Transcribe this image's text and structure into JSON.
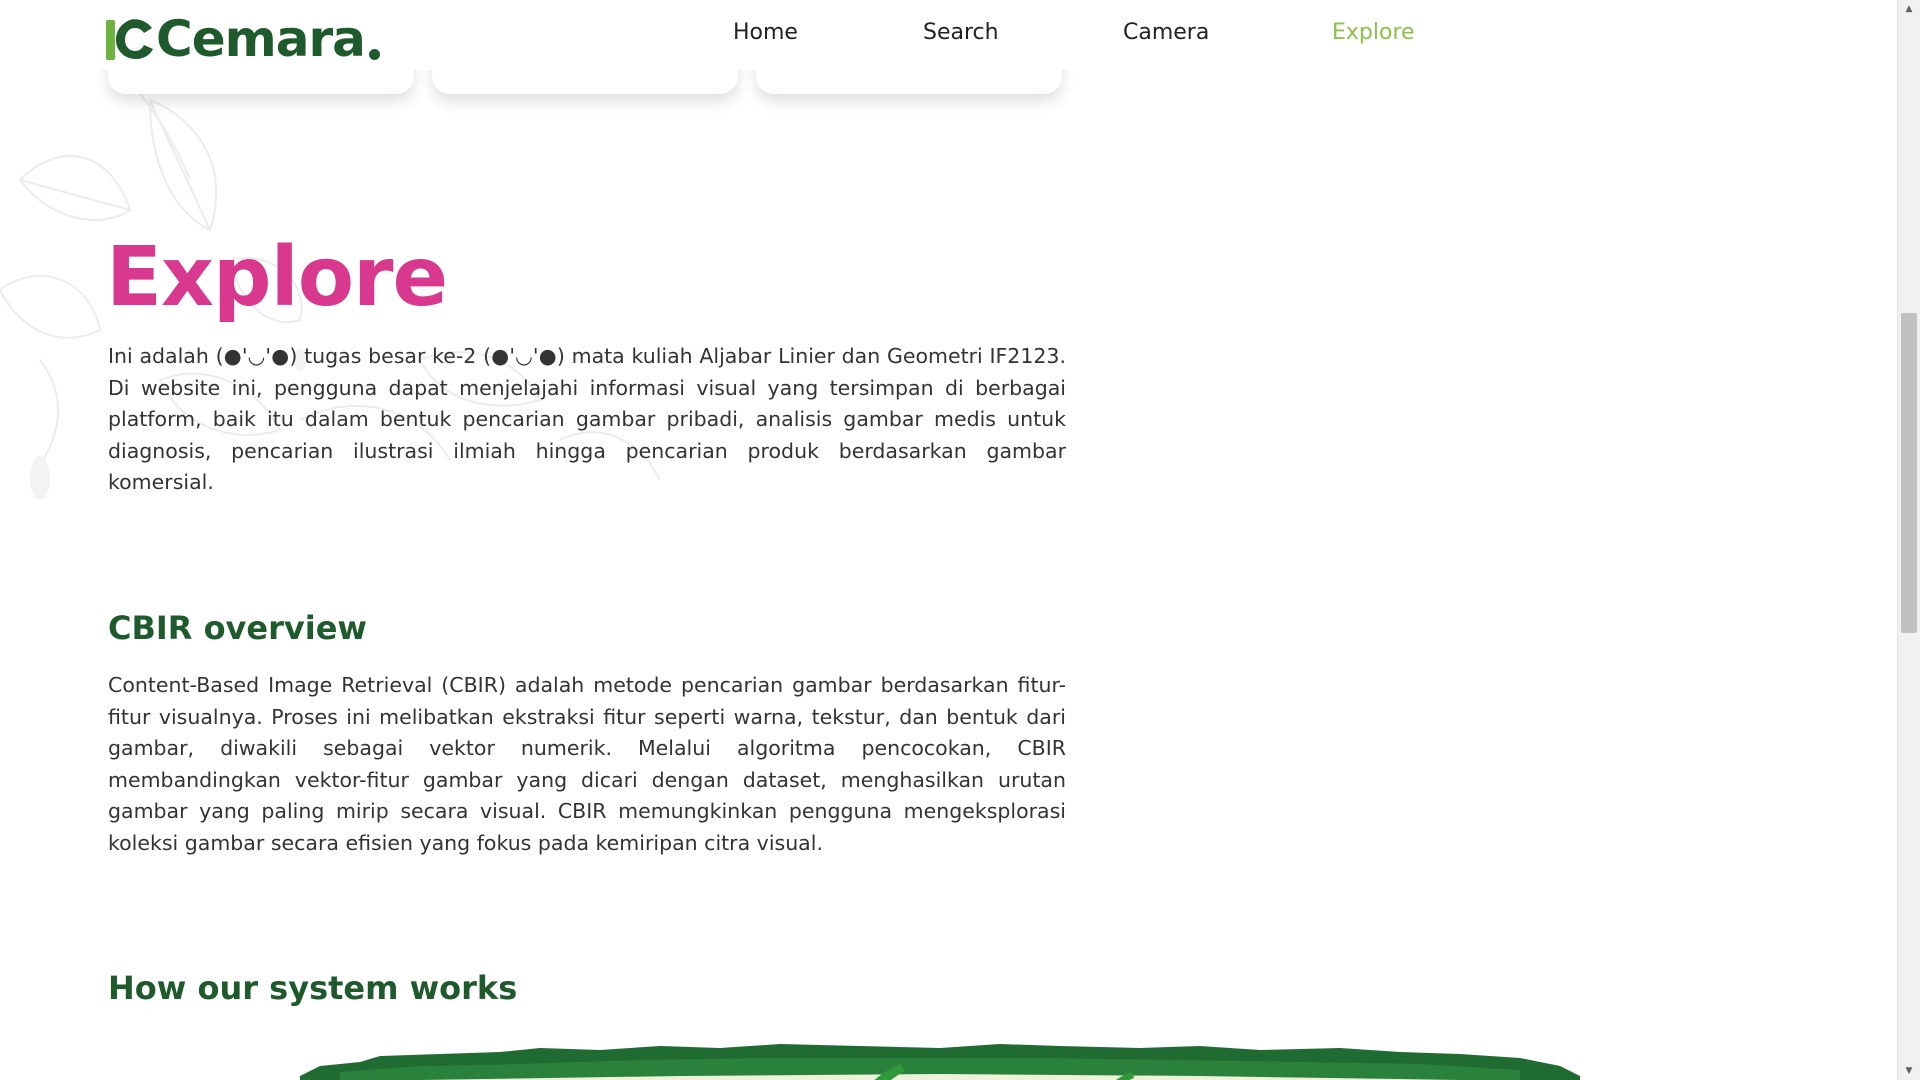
{
  "brand": {
    "logo_text": "Cemara",
    "logo_dot": ".",
    "colors": {
      "brand_green": "#1e5a2b",
      "light_green": "#6cb33f",
      "accent_pink": "#d9388f",
      "active_nav": "#8dc04a"
    }
  },
  "nav": {
    "items": [
      {
        "label": "Home",
        "active": false
      },
      {
        "label": "Search",
        "active": false
      },
      {
        "label": "Camera",
        "active": false
      },
      {
        "label": "Explore",
        "active": true
      }
    ]
  },
  "main": {
    "title": "Explore",
    "intro": "Ini adalah (●'◡'●) tugas besar ke-2 (●'◡'●) mata kuliah Aljabar Linier dan Geometri IF2123. Di website ini, pengguna dapat menjelajahi informasi visual yang tersimpan di berbagai platform, baik itu dalam bentuk pencarian gambar pribadi, analisis gambar medis untuk diagnosis, pencarian ilustrasi ilmiah hingga pencarian produk berdasarkan gambar komersial.",
    "cbir_heading": "CBIR overview",
    "cbir_text": "Content-Based Image Retrieval (CBIR) adalah metode pencarian gambar berdasarkan fitur-fitur visualnya. Proses ini melibatkan ekstraksi fitur seperti warna, tekstur, dan bentuk dari gambar, diwakili sebagai vektor numerik. Melalui algoritma pencocokan, CBIR membandingkan vektor-fitur gambar yang dicari dengan dataset, menghasilkan urutan gambar yang paling mirip secara visual. CBIR memungkinkan pengguna mengeksplorasi koleksi gambar secara efisien yang fokus pada kemiripan citra visual.",
    "how_heading": "How our system works"
  },
  "icons": {
    "scroll_up": "scroll-up-arrow-icon",
    "scroll_down": "scroll-down-arrow-icon",
    "leaf_bg": "leaf-pattern-icon"
  }
}
